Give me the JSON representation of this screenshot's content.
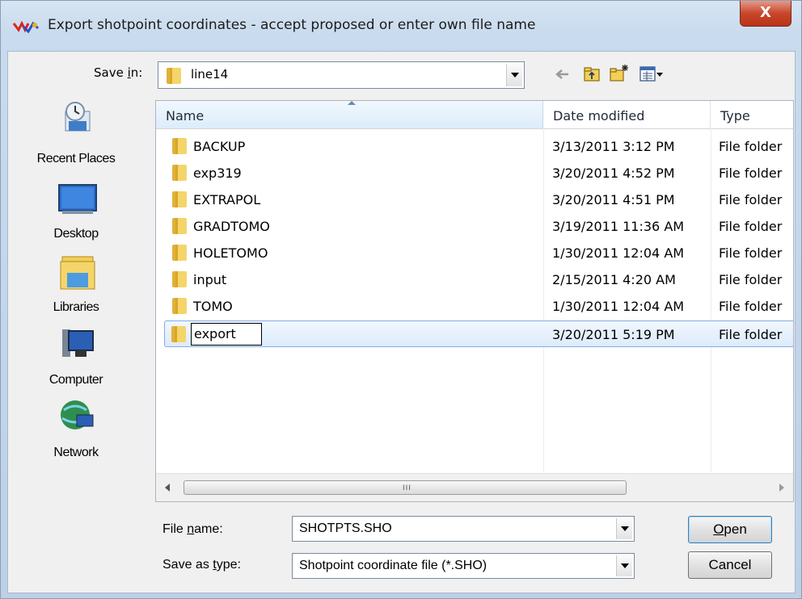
{
  "window": {
    "title": "Export shotpoint coordinates - accept proposed or enter own file name",
    "close_label": "X"
  },
  "save_in": {
    "label_pre": "Save ",
    "label_u": "i",
    "label_post": "n:",
    "value": "line14"
  },
  "toolbar": {
    "icons": [
      "back-arrow-icon",
      "up-folder-icon",
      "new-folder-icon",
      "view-menu-icon"
    ]
  },
  "places": [
    {
      "label": "Recent Places",
      "icon": "recent-places-icon"
    },
    {
      "label": "Desktop",
      "icon": "desktop-icon"
    },
    {
      "label": "Libraries",
      "icon": "libraries-icon"
    },
    {
      "label": "Computer",
      "icon": "computer-icon"
    },
    {
      "label": "Network",
      "icon": "network-icon"
    }
  ],
  "columns": [
    "Name",
    "Date modified",
    "Type"
  ],
  "files": [
    {
      "name": "BACKUP",
      "date": "3/13/2011 3:12 PM",
      "type": "File folder"
    },
    {
      "name": "exp319",
      "date": "3/20/2011 4:52 PM",
      "type": "File folder"
    },
    {
      "name": "EXTRAPOL",
      "date": "3/20/2011 4:51 PM",
      "type": "File folder"
    },
    {
      "name": "GRADTOMO",
      "date": "3/19/2011 11:36 AM",
      "type": "File folder"
    },
    {
      "name": "HOLETOMO",
      "date": "1/30/2011 12:04 AM",
      "type": "File folder"
    },
    {
      "name": "input",
      "date": "2/15/2011 4:20 AM",
      "type": "File folder"
    },
    {
      "name": "TOMO",
      "date": "1/30/2011 12:04 AM",
      "type": "File folder"
    },
    {
      "name": "export",
      "date": "3/20/2011 5:19 PM",
      "type": "File folder"
    }
  ],
  "file_name": {
    "label_pre": "File ",
    "label_u": "n",
    "label_post": "ame:",
    "value": "SHOTPTS.SHO"
  },
  "save_as_type": {
    "label_pre": "Save as ",
    "label_u": "t",
    "label_post": "ype:",
    "value": "Shotpoint coordinate file (*.SHO)"
  },
  "buttons": {
    "open_u": "O",
    "open_rest": "pen",
    "cancel": "Cancel"
  },
  "scroll_grip": "III"
}
